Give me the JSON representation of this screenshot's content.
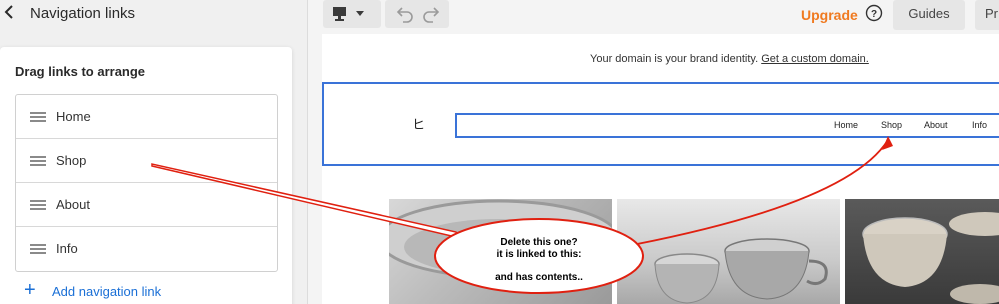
{
  "panel": {
    "title": "Navigation links",
    "heading": "Drag links to arrange",
    "links": [
      {
        "label": "Home"
      },
      {
        "label": "Shop"
      },
      {
        "label": "About"
      },
      {
        "label": "Info"
      }
    ],
    "add_label": "Add navigation link"
  },
  "toolbar": {
    "upgrade": "Upgrade",
    "guides": "Guides",
    "cut_button": "Pr",
    "icons": [
      "desktop-icon",
      "caret-down-icon",
      "undo-icon",
      "redo-icon",
      "help-icon"
    ]
  },
  "preview": {
    "domain_text": "Your domain is your brand identity.",
    "domain_link": "Get a custom domain.",
    "logo": "ヒ",
    "nav": [
      {
        "label": "Home"
      },
      {
        "label": "Shop"
      },
      {
        "label": "About"
      },
      {
        "label": "Info"
      }
    ]
  },
  "annotation": {
    "line1": "Delete this one?",
    "line2": "it is linked to this:",
    "line3": "and has contents..",
    "color": "#e02010"
  },
  "colors": {
    "accent": "#1a6fd6",
    "upgrade": "#f07a20",
    "selection": "#3a73d8"
  }
}
